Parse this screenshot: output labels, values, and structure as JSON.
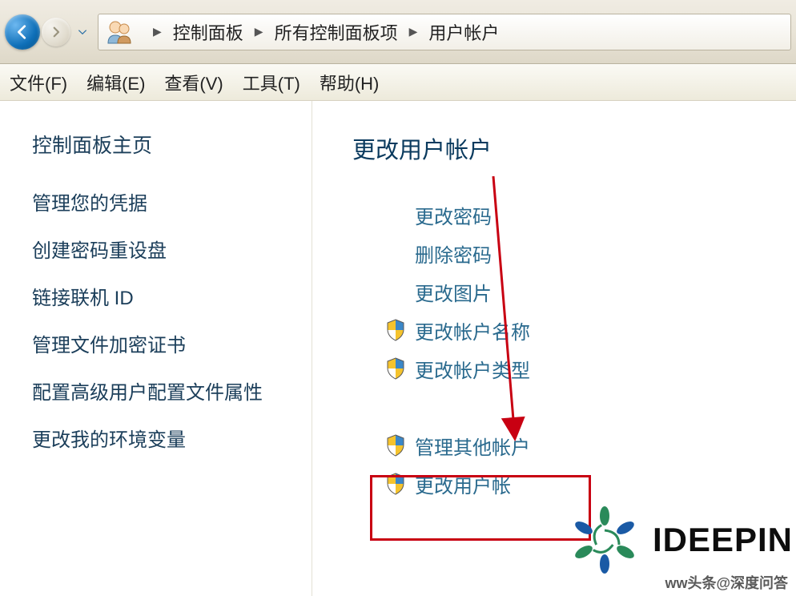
{
  "breadcrumb": {
    "items": [
      "控制面板",
      "所有控制面板项",
      "用户帐户"
    ]
  },
  "menu": {
    "items": [
      "文件(F)",
      "编辑(E)",
      "查看(V)",
      "工具(T)",
      "帮助(H)"
    ]
  },
  "sidebar": {
    "title": "控制面板主页",
    "links": [
      "管理您的凭据",
      "创建密码重设盘",
      "链接联机 ID",
      "管理文件加密证书",
      "配置高级用户配置文件属性",
      "更改我的环境变量"
    ]
  },
  "main": {
    "title": "更改用户帐户",
    "group1": [
      {
        "shield": false,
        "label": "更改密码"
      },
      {
        "shield": false,
        "label": "删除密码"
      },
      {
        "shield": false,
        "label": "更改图片"
      },
      {
        "shield": true,
        "label": "更改帐户名称"
      },
      {
        "shield": true,
        "label": "更改帐户类型"
      }
    ],
    "group2": [
      {
        "shield": true,
        "label": "管理其他帐户"
      },
      {
        "shield": true,
        "label": "更改用户帐"
      }
    ]
  },
  "watermark": {
    "logo_text": "IDEEPIN",
    "line": "ww头条@深度问答"
  }
}
